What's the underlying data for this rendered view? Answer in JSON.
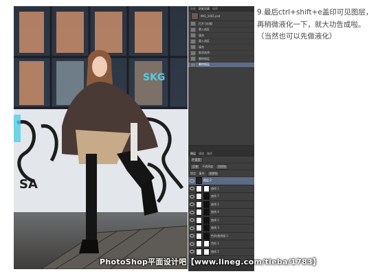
{
  "photo": {
    "caption": ""
  },
  "history_panel": {
    "tabs": [
      "历史",
      "历史记录",
      "动作"
    ],
    "snapshot_name": "IMG_1065.psd",
    "items": [
      "打开 (存储)",
      "载入选区",
      "填充",
      "载入选区",
      "填充",
      "取消选择",
      "删除图层",
      "删除图层"
    ],
    "selected_index": 7
  },
  "layers_panel": {
    "tabs": [
      "图层",
      "通道",
      "路径"
    ],
    "kind_label": "P 类型",
    "blend_mode": "正常",
    "opacity_label": "不透明度:",
    "opacity_value": "100%",
    "lock_label": "锁定:",
    "fill_label": "填充:",
    "fill_value": "100%",
    "layers": [
      {
        "name": "图层 2",
        "selected": true,
        "thumb": "photo"
      },
      {
        "name": "曲线 1",
        "thumb": "white",
        "mask": "white"
      },
      {
        "name": "曲线 7",
        "thumb": "white",
        "mask": "dark"
      },
      {
        "name": "曲线 5",
        "thumb": "white",
        "mask": "dark"
      },
      {
        "name": "曲线 4",
        "thumb": "white",
        "mask": "dark"
      },
      {
        "name": "曲线 1",
        "thumb": "white",
        "mask": "dark"
      },
      {
        "name": "曲线 3",
        "thumb": "white",
        "mask": "dark"
      },
      {
        "name": "色阶/曲线组 1",
        "thumb": "white",
        "mask": "dark"
      },
      {
        "name": "色阶 1",
        "thumb": "white",
        "mask": "white"
      },
      {
        "name": "曲线 2",
        "thumb": "white",
        "mask": "white"
      }
    ]
  },
  "instruction": {
    "text": "9.最后ctrl+shift+e盖印可见图层，再稍微液化一下，就大功告成啦。（当然也可以先做液化）"
  },
  "watermark": {
    "text": "PhotoShop平面设计吧【www.lineg.com/tieba/1783】"
  },
  "colors": {
    "panel_bg": "#3e3e3e",
    "selection": "#5d6b86",
    "text": "#444444"
  }
}
